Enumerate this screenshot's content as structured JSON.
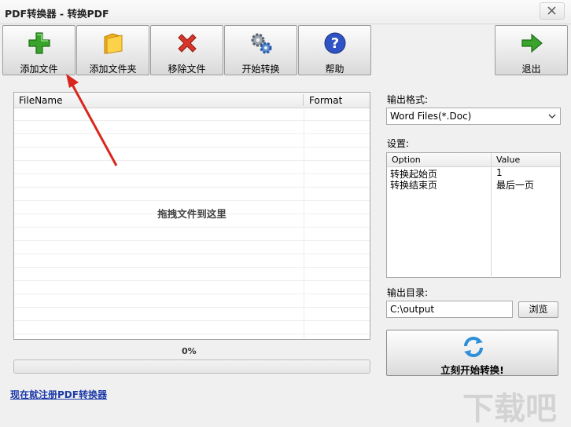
{
  "window": {
    "title": "PDF转换器 - 转换PDF"
  },
  "toolbar": {
    "add_file": "添加文件",
    "add_folder": "添加文件夹",
    "remove_file": "移除文件",
    "start_convert": "开始转换",
    "help": "帮助",
    "exit": "退出"
  },
  "file_list": {
    "columns": [
      "FileName",
      "Format"
    ],
    "drop_hint": "拖拽文件到这里",
    "rows": []
  },
  "progress": {
    "text": "0%",
    "fraction": 0
  },
  "register_link": "现在就注册PDF转换器",
  "output_format": {
    "label": "输出格式:",
    "selected": "Word Files(*.Doc)"
  },
  "settings": {
    "label": "设置:",
    "headers": [
      "Option",
      "Value"
    ],
    "rows": [
      {
        "option": "转换起始页",
        "value": "1"
      },
      {
        "option": "转换结束页",
        "value": "最后一页"
      }
    ]
  },
  "output_dir": {
    "label": "输出目录:",
    "value": "C:\\output",
    "browse": "浏览"
  },
  "convert_now": "立刻开始转换!",
  "watermark": "下载吧",
  "icons": {
    "add": "plus-icon",
    "folder": "folder-icon",
    "remove": "x-icon",
    "convert": "gears-icon",
    "help": "question-icon",
    "exit": "arrow-right-icon",
    "refresh": "refresh-icon"
  },
  "colors": {
    "add_green": "#3aa32c",
    "remove_red": "#d8362a",
    "help_blue": "#2f53c4",
    "annotation_red": "#d9261c",
    "link_blue": "#1c3aa8"
  }
}
